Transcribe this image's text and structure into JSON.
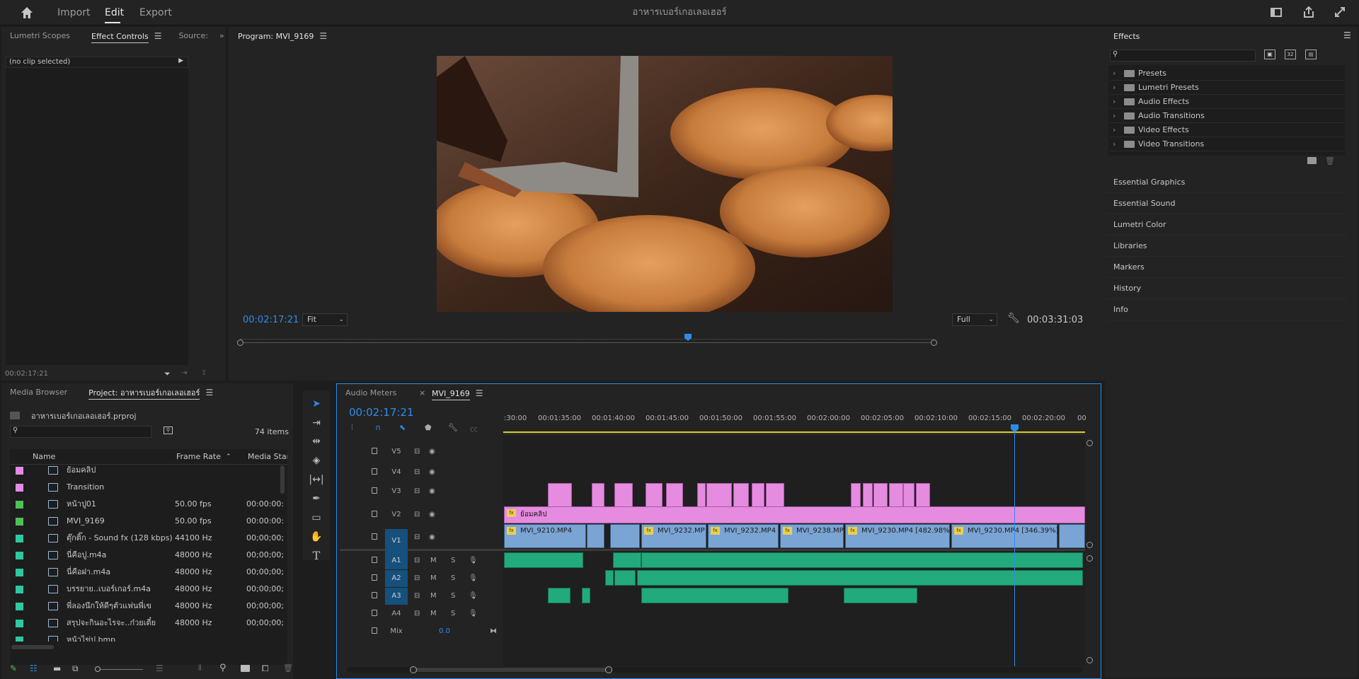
{
  "header": {
    "nav": [
      "Import",
      "Edit",
      "Export"
    ],
    "active_nav": "Edit",
    "project_title": "อาหารเบอร์เกอเลอเฮอร์"
  },
  "source_panel": {
    "tabs": [
      "Lumetri Scopes",
      "Effect Controls",
      "Source:"
    ],
    "active_tab": "Effect Controls",
    "no_clip": "(no clip selected)",
    "timecode": "00:02:17:21"
  },
  "program": {
    "title": "Program: MVI_9169",
    "timecode_current": "00:02:17:21",
    "fit": "Fit",
    "quality": "Full",
    "timecode_duration": "00:03:31:03",
    "playhead_fraction": 0.646
  },
  "project_panel": {
    "tabs": [
      "Media Browser",
      "Project: อาหารเบอร์เกอเลอเฮอร์"
    ],
    "file": "อาหารเบอร์เกอเลอเฮอร์.prproj",
    "items_count": "74 items",
    "columns": [
      "Name",
      "Frame Rate",
      "Media Start"
    ],
    "rows": [
      {
        "name": "ย้อมคลิป",
        "rate": "",
        "start": "",
        "color": "#e38ae2",
        "icon": "sequence-icon"
      },
      {
        "name": "Transition",
        "rate": "",
        "start": "",
        "color": "#e38ae2",
        "icon": "sequence-icon"
      },
      {
        "name": "หน้าปู01",
        "rate": "50.00 fps",
        "start": "00:00:00:",
        "color": "#4fbf56",
        "icon": "clip-icon"
      },
      {
        "name": "MVI_9169",
        "rate": "50.00 fps",
        "start": "00:00:00:",
        "color": "#4fbf56",
        "icon": "clip-icon"
      },
      {
        "name": "ตุ๊กติ๊ก - Sound fx (128 kbps)",
        "rate": "44100 Hz",
        "start": "00;00;00;",
        "color": "#2fc8a0",
        "icon": "audio-icon"
      },
      {
        "name": "นี่คือปู.m4a",
        "rate": "48000 Hz",
        "start": "00;00;00;",
        "color": "#2fc8a0",
        "icon": "audio-icon"
      },
      {
        "name": "นี่คือฝา.m4a",
        "rate": "48000 Hz",
        "start": "00;00;00;",
        "color": "#2fc8a0",
        "icon": "audio-icon"
      },
      {
        "name": "บรรยาย..เบอร์เกอร์.m4a",
        "rate": "48000 Hz",
        "start": "00;00;00;",
        "color": "#2fc8a0",
        "icon": "audio-icon"
      },
      {
        "name": "พี่ลองนึกให้ดีๆตัวแฟนพี่เข",
        "rate": "48000 Hz",
        "start": "00;00;00;",
        "color": "#2fc8a0",
        "icon": "audio-icon"
      },
      {
        "name": "สรุปจะกินอะไรจะ..ก๋วยเตี๋ย",
        "rate": "48000 Hz",
        "start": "00;00;00;",
        "color": "#2fc8a0",
        "icon": "audio-icon"
      },
      {
        "name": "หน้าไข่ปู.bmp",
        "rate": "",
        "start": "",
        "color": "#2fc8a0",
        "icon": "image-icon"
      }
    ]
  },
  "timeline": {
    "tabs": [
      "Audio Meters",
      "MVI_9169"
    ],
    "active_tab": "MVI_9169",
    "timecode": "00:02:17:21",
    "ruler": [
      ":30:00",
      "00:01:35:00",
      "00:01:40:00",
      "00:01:45:00",
      "00:01:50:00",
      "00:01:55:00",
      "00:02:00:00",
      "00:02:05:00",
      "00:02:10:00",
      "00:02:15:00",
      "00:02:20:00",
      "00"
    ],
    "video_tracks": [
      "V5",
      "V4",
      "V3",
      "V2",
      "V1"
    ],
    "audio_tracks": [
      "A1",
      "A2",
      "A3",
      "A4"
    ],
    "mix_label": "Mix",
    "mix_value": "0.0",
    "track_buttons": {
      "mute": "M",
      "solo": "S"
    },
    "v2_clip": "ย้อมคลิป",
    "v1_clips": [
      "MVI_9210.MP4",
      "MVI_9232.MP",
      "MVI_9232.MP4 [",
      "MVI_9238.MP",
      "MVI_9230.MP4 [482.98%]",
      "MVI_9230.MP4 [346.39%]"
    ]
  },
  "effects": {
    "title": "Effects",
    "folders": [
      "Presets",
      "Lumetri Presets",
      "Audio Effects",
      "Audio Transitions",
      "Video Effects",
      "Video Transitions"
    ],
    "sections": [
      "Essential Graphics",
      "Essential Sound",
      "Lumetri Color",
      "Libraries",
      "Markers",
      "History",
      "Info"
    ]
  },
  "colors": {
    "accent": "#2d8ceb",
    "video_clip": "#7aa4d4",
    "pink_clip": "#e58be0",
    "audio_clip": "#23aa7c"
  }
}
